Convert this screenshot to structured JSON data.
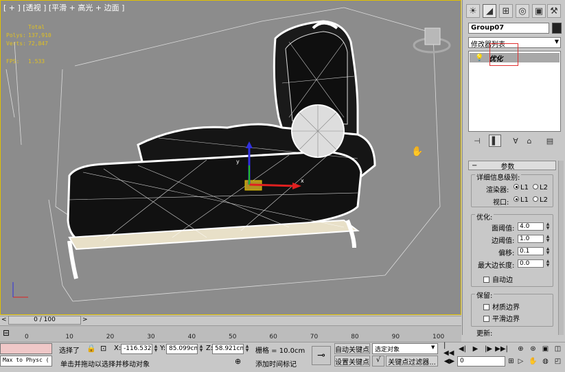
{
  "viewport": {
    "label": "[ + ] [透视 ] [平滑 + 高光 + 边面 ]",
    "stats": {
      "total_label": "Total",
      "polys_label": "Polys:",
      "polys_value": "137,910",
      "verts_label": "Verts:",
      "verts_value": "72,847",
      "fps_label": "FPS:",
      "fps_value": "1.533"
    },
    "axis_x": "x",
    "axis_y": "y"
  },
  "panel": {
    "tabs": [
      "create",
      "modify",
      "hierarchy",
      "motion",
      "display",
      "utilities"
    ],
    "object_name": "Group07",
    "modifier_list": "修改器列表",
    "stack_item": "优化",
    "rollout_title": "参数",
    "lod_title": "详细信息级别:",
    "renderer_label": "渲染器:",
    "viewport_label": "视口:",
    "l1": "L1",
    "l2": "L2",
    "optimize_title": "优化:",
    "face_thresh_label": "面阈值:",
    "face_thresh": "4.0",
    "edge_thresh_label": "边阈值:",
    "edge_thresh": "1.0",
    "bias_label": "偏移:",
    "bias": "0.1",
    "max_edge_label": "最大边长度:",
    "max_edge": "0.0",
    "auto_edge": "自动边",
    "preserve_title": "保留:",
    "material_boundary": "材质边界",
    "smooth_boundary": "平滑边界",
    "update_title": "更新:"
  },
  "timeline": {
    "slider": "0 / 100",
    "ticks": [
      "0",
      "10",
      "20",
      "30",
      "40",
      "50",
      "60",
      "70",
      "80",
      "90",
      "100"
    ]
  },
  "status": {
    "maxscript": "Max to Physc (",
    "selected": "选择了",
    "x_label": "X:",
    "x_value": "-116.532cm",
    "y_label": "Y:",
    "y_value": "85.099cm",
    "z_label": "Z:",
    "z_value": "58.921cm",
    "grid": "栅格 = 10.0cm",
    "prompt": "单击并拖动以选择并移动对象",
    "add_time_tag": "添加时间标记",
    "auto_key": "自动关键点",
    "set_key": "设置关键点",
    "selection_set": "选定对象",
    "key_filters": "关键点过滤器...",
    "frame": "0"
  }
}
